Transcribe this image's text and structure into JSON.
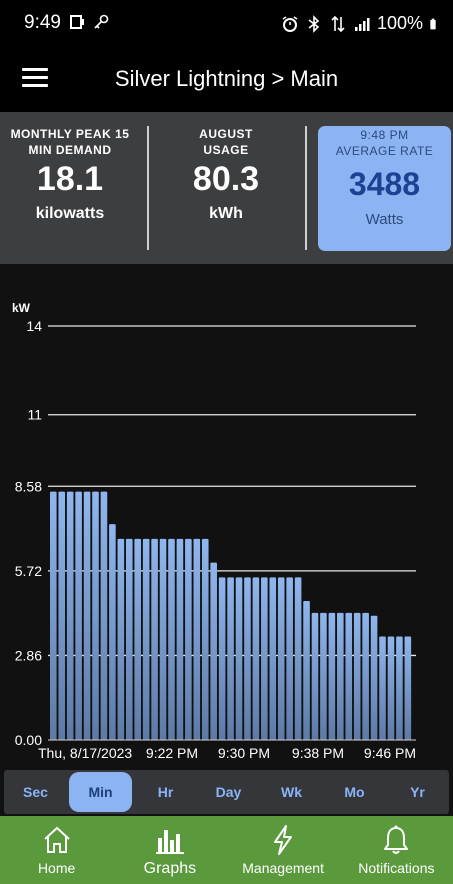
{
  "status_bar": {
    "time": "9:49",
    "battery": "100%"
  },
  "header": {
    "title": "Silver Lightning > Main"
  },
  "stats": {
    "peak": {
      "label_line1": "MONTHLY PEAK 15",
      "label_line2": "MIN DEMAND",
      "value": "18.1",
      "unit": "kilowatts"
    },
    "usage": {
      "label_line1": "AUGUST",
      "label_line2": "USAGE",
      "value": "80.3",
      "unit": "kWh"
    },
    "rate": {
      "time": "9:48 PM",
      "label": "AVERAGE RATE",
      "value": "3488",
      "unit": "Watts",
      "accent": "#8db4f2"
    }
  },
  "chart_data": {
    "type": "bar",
    "ylabel": "kW",
    "ylim": [
      0,
      14
    ],
    "y_ticks": [
      "0.00",
      "2.86",
      "5.72",
      "8.58",
      "11",
      "14"
    ],
    "y_tick_values": [
      0,
      2.86,
      5.72,
      8.58,
      11,
      14
    ],
    "x_ticks": [
      "Thu, 8/17/2023",
      "9:22 PM",
      "9:30 PM",
      "9:38 PM",
      "9:46 PM"
    ],
    "values": [
      8.4,
      8.4,
      8.4,
      8.4,
      8.4,
      8.4,
      8.4,
      7.3,
      6.8,
      6.8,
      6.8,
      6.8,
      6.8,
      6.8,
      6.8,
      6.8,
      6.8,
      6.8,
      6.8,
      6.0,
      5.5,
      5.5,
      5.5,
      5.5,
      5.5,
      5.5,
      5.5,
      5.5,
      5.5,
      5.5,
      4.7,
      4.3,
      4.3,
      4.3,
      4.3,
      4.3,
      4.3,
      4.3,
      4.2,
      3.5,
      3.5,
      3.5,
      3.5
    ],
    "bar_color": "#8ab0e6",
    "grid": true
  },
  "range_tabs": [
    {
      "label": "Sec",
      "active": false
    },
    {
      "label": "Min",
      "active": true
    },
    {
      "label": "Hr",
      "active": false
    },
    {
      "label": "Day",
      "active": false
    },
    {
      "label": "Wk",
      "active": false
    },
    {
      "label": "Mo",
      "active": false
    },
    {
      "label": "Yr",
      "active": false
    }
  ],
  "bottom_nav": [
    {
      "label": "Home",
      "icon": "home-icon"
    },
    {
      "label": "Graphs",
      "icon": "graphs-icon"
    },
    {
      "label": "Management",
      "icon": "lightning-icon"
    },
    {
      "label": "Notifications",
      "icon": "bell-icon"
    }
  ],
  "colors": {
    "nav_bg": "#5b9a3c",
    "stats_bg": "#3d3e40",
    "accent": "#8db4f2"
  }
}
